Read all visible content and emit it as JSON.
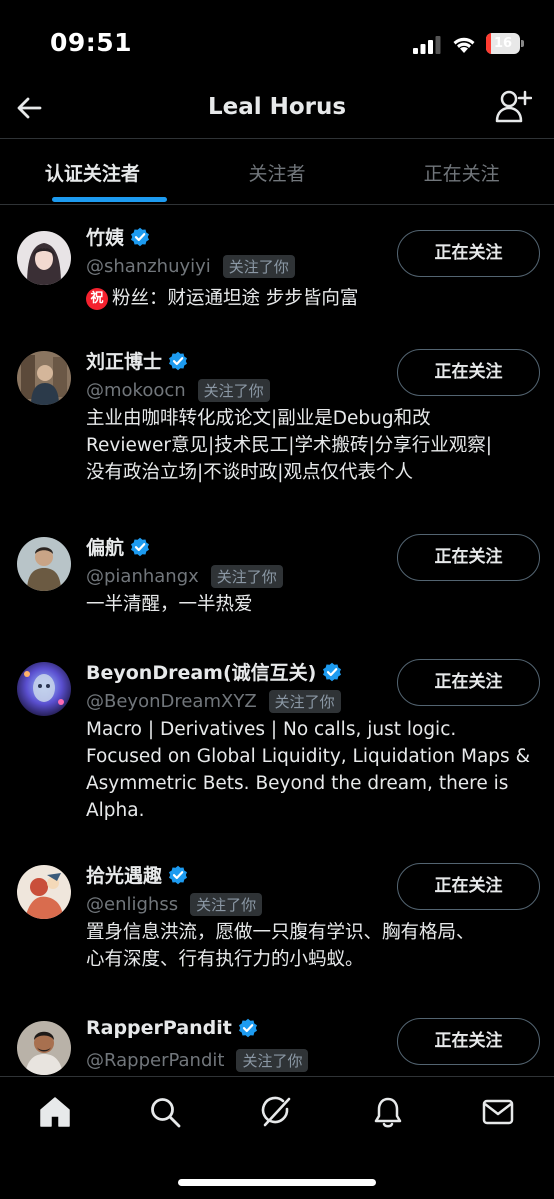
{
  "status_bar": {
    "time": "09:51",
    "battery_level": "16",
    "battery_color": "#ff3b30"
  },
  "header": {
    "title": "Leal Horus",
    "back_icon": "arrow-left-icon",
    "action_icon": "add-user-icon"
  },
  "tabs": [
    {
      "label": "认证关注者",
      "active": true
    },
    {
      "label": "关注者",
      "active": false
    },
    {
      "label": "正在关注",
      "active": false
    }
  ],
  "users": [
    {
      "name": "竹姨",
      "handle": "@shanzhuyiyi",
      "follows_you": "关注了你",
      "button": "正在关注",
      "bio_badge": "祝",
      "bio": [
        "粉丝：财运通坦途 步步皆向富"
      ]
    },
    {
      "name": "刘正博士",
      "handle": "@mokoocn",
      "follows_you": "关注了你",
      "button": "正在关注",
      "bio": [
        "主业由咖啡转化成论文|副业是Debug和改",
        "Reviewer意见|技术民工|学术搬砖|分享行业观察|",
        "没有政治立场|不谈时政|观点仅代表个人"
      ]
    },
    {
      "name": "偏航",
      "handle": "@pianhangx",
      "follows_you": "关注了你",
      "button": "正在关注",
      "bio": [
        "一半清醒，一半热爱"
      ]
    },
    {
      "name": "BeyonDream(诚信互关)",
      "handle": "@BeyonDreamXYZ",
      "follows_you": "关注了你",
      "button": "正在关注",
      "bio": [
        "Macro | Derivatives | No calls, just logic.",
        "Focused on Global Liquidity, Liquidation Maps &",
        "Asymmetric Bets. Beyond the dream, there is",
        "Alpha."
      ]
    },
    {
      "name": "拾光遇趣",
      "handle": "@enlighss",
      "follows_you": "关注了你",
      "button": "正在关注",
      "bio": [
        "置身信息洪流，愿做一只腹有学识、胸有格局、",
        "心有深度、行有执行力的小蚂蚁。"
      ]
    },
    {
      "name": "RapperPandit",
      "handle": "@RapperPandit",
      "follows_you": "关注了你",
      "button": "正在关注",
      "bio": []
    }
  ],
  "bottom_nav": [
    "home-icon",
    "search-icon",
    "grok-icon",
    "notifications-icon",
    "messages-icon"
  ],
  "colors": {
    "accent": "#1d9bf0",
    "background": "#000000",
    "muted_text": "#71767b",
    "divider": "#2f3336"
  }
}
